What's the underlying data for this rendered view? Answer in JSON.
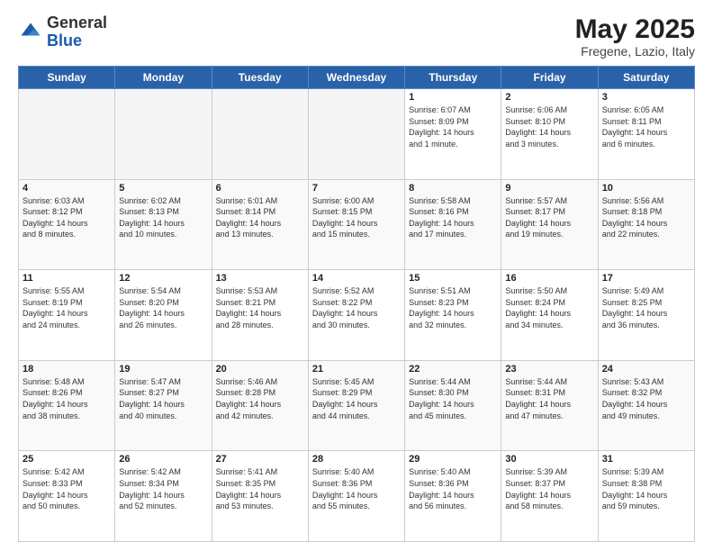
{
  "header": {
    "logo_general": "General",
    "logo_blue": "Blue",
    "month_title": "May 2025",
    "location": "Fregene, Lazio, Italy"
  },
  "weekdays": [
    "Sunday",
    "Monday",
    "Tuesday",
    "Wednesday",
    "Thursday",
    "Friday",
    "Saturday"
  ],
  "weeks": [
    [
      {
        "day": "",
        "info": ""
      },
      {
        "day": "",
        "info": ""
      },
      {
        "day": "",
        "info": ""
      },
      {
        "day": "",
        "info": ""
      },
      {
        "day": "1",
        "info": "Sunrise: 6:07 AM\nSunset: 8:09 PM\nDaylight: 14 hours\nand 1 minute."
      },
      {
        "day": "2",
        "info": "Sunrise: 6:06 AM\nSunset: 8:10 PM\nDaylight: 14 hours\nand 3 minutes."
      },
      {
        "day": "3",
        "info": "Sunrise: 6:05 AM\nSunset: 8:11 PM\nDaylight: 14 hours\nand 6 minutes."
      }
    ],
    [
      {
        "day": "4",
        "info": "Sunrise: 6:03 AM\nSunset: 8:12 PM\nDaylight: 14 hours\nand 8 minutes."
      },
      {
        "day": "5",
        "info": "Sunrise: 6:02 AM\nSunset: 8:13 PM\nDaylight: 14 hours\nand 10 minutes."
      },
      {
        "day": "6",
        "info": "Sunrise: 6:01 AM\nSunset: 8:14 PM\nDaylight: 14 hours\nand 13 minutes."
      },
      {
        "day": "7",
        "info": "Sunrise: 6:00 AM\nSunset: 8:15 PM\nDaylight: 14 hours\nand 15 minutes."
      },
      {
        "day": "8",
        "info": "Sunrise: 5:58 AM\nSunset: 8:16 PM\nDaylight: 14 hours\nand 17 minutes."
      },
      {
        "day": "9",
        "info": "Sunrise: 5:57 AM\nSunset: 8:17 PM\nDaylight: 14 hours\nand 19 minutes."
      },
      {
        "day": "10",
        "info": "Sunrise: 5:56 AM\nSunset: 8:18 PM\nDaylight: 14 hours\nand 22 minutes."
      }
    ],
    [
      {
        "day": "11",
        "info": "Sunrise: 5:55 AM\nSunset: 8:19 PM\nDaylight: 14 hours\nand 24 minutes."
      },
      {
        "day": "12",
        "info": "Sunrise: 5:54 AM\nSunset: 8:20 PM\nDaylight: 14 hours\nand 26 minutes."
      },
      {
        "day": "13",
        "info": "Sunrise: 5:53 AM\nSunset: 8:21 PM\nDaylight: 14 hours\nand 28 minutes."
      },
      {
        "day": "14",
        "info": "Sunrise: 5:52 AM\nSunset: 8:22 PM\nDaylight: 14 hours\nand 30 minutes."
      },
      {
        "day": "15",
        "info": "Sunrise: 5:51 AM\nSunset: 8:23 PM\nDaylight: 14 hours\nand 32 minutes."
      },
      {
        "day": "16",
        "info": "Sunrise: 5:50 AM\nSunset: 8:24 PM\nDaylight: 14 hours\nand 34 minutes."
      },
      {
        "day": "17",
        "info": "Sunrise: 5:49 AM\nSunset: 8:25 PM\nDaylight: 14 hours\nand 36 minutes."
      }
    ],
    [
      {
        "day": "18",
        "info": "Sunrise: 5:48 AM\nSunset: 8:26 PM\nDaylight: 14 hours\nand 38 minutes."
      },
      {
        "day": "19",
        "info": "Sunrise: 5:47 AM\nSunset: 8:27 PM\nDaylight: 14 hours\nand 40 minutes."
      },
      {
        "day": "20",
        "info": "Sunrise: 5:46 AM\nSunset: 8:28 PM\nDaylight: 14 hours\nand 42 minutes."
      },
      {
        "day": "21",
        "info": "Sunrise: 5:45 AM\nSunset: 8:29 PM\nDaylight: 14 hours\nand 44 minutes."
      },
      {
        "day": "22",
        "info": "Sunrise: 5:44 AM\nSunset: 8:30 PM\nDaylight: 14 hours\nand 45 minutes."
      },
      {
        "day": "23",
        "info": "Sunrise: 5:44 AM\nSunset: 8:31 PM\nDaylight: 14 hours\nand 47 minutes."
      },
      {
        "day": "24",
        "info": "Sunrise: 5:43 AM\nSunset: 8:32 PM\nDaylight: 14 hours\nand 49 minutes."
      }
    ],
    [
      {
        "day": "25",
        "info": "Sunrise: 5:42 AM\nSunset: 8:33 PM\nDaylight: 14 hours\nand 50 minutes."
      },
      {
        "day": "26",
        "info": "Sunrise: 5:42 AM\nSunset: 8:34 PM\nDaylight: 14 hours\nand 52 minutes."
      },
      {
        "day": "27",
        "info": "Sunrise: 5:41 AM\nSunset: 8:35 PM\nDaylight: 14 hours\nand 53 minutes."
      },
      {
        "day": "28",
        "info": "Sunrise: 5:40 AM\nSunset: 8:36 PM\nDaylight: 14 hours\nand 55 minutes."
      },
      {
        "day": "29",
        "info": "Sunrise: 5:40 AM\nSunset: 8:36 PM\nDaylight: 14 hours\nand 56 minutes."
      },
      {
        "day": "30",
        "info": "Sunrise: 5:39 AM\nSunset: 8:37 PM\nDaylight: 14 hours\nand 58 minutes."
      },
      {
        "day": "31",
        "info": "Sunrise: 5:39 AM\nSunset: 8:38 PM\nDaylight: 14 hours\nand 59 minutes."
      }
    ]
  ]
}
